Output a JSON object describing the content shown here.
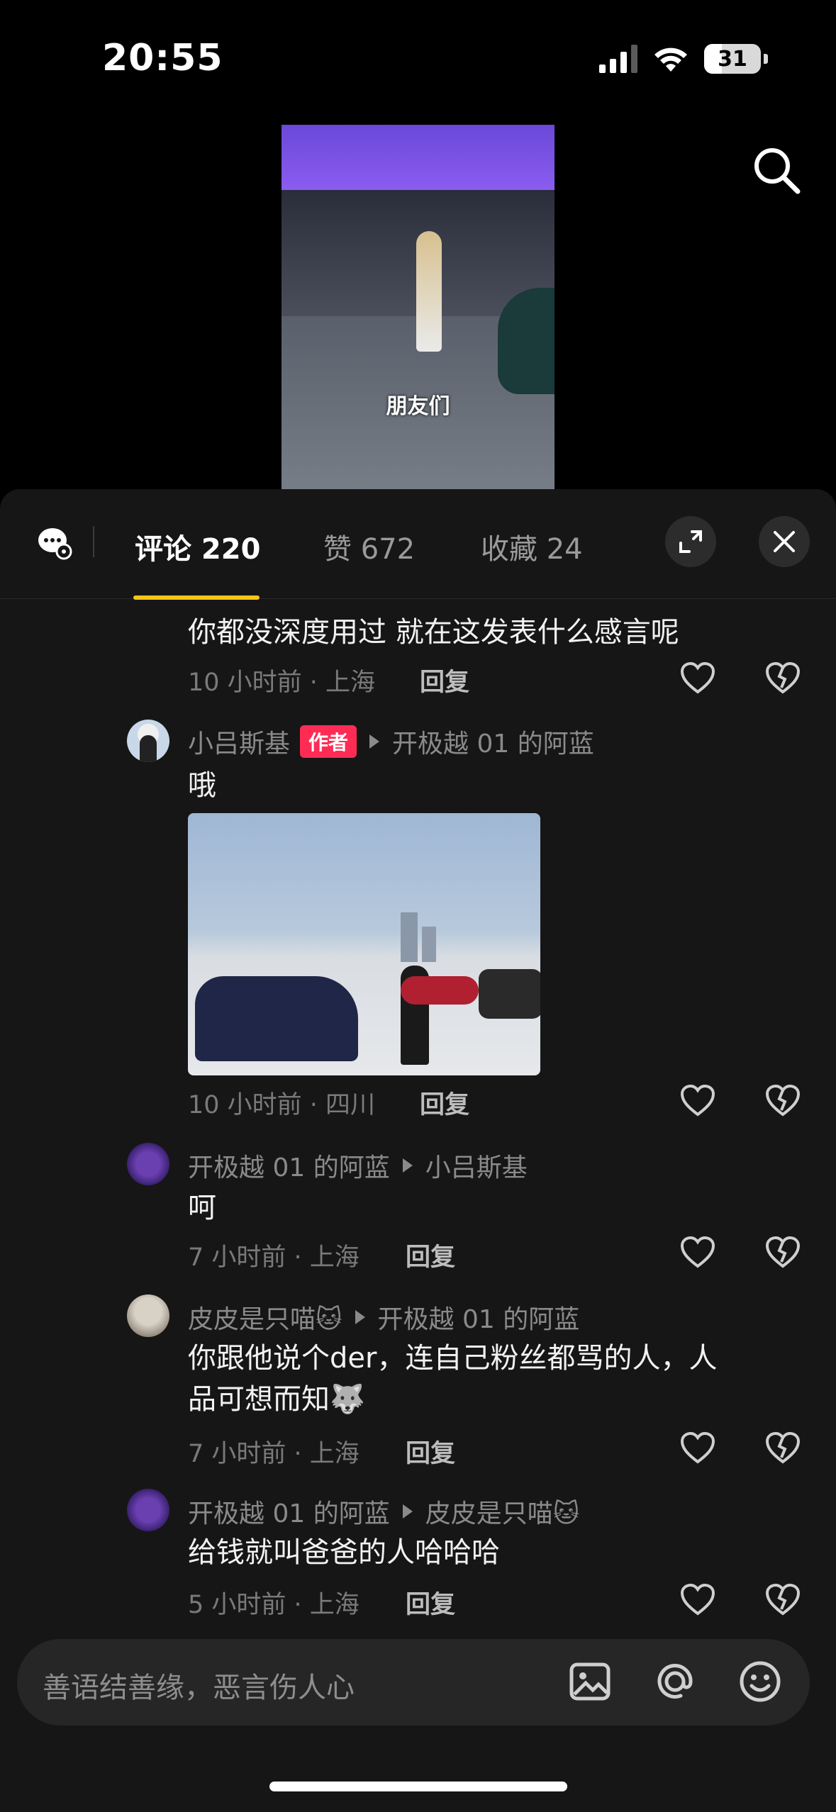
{
  "status_bar": {
    "time": "20:55",
    "battery": "31"
  },
  "video": {
    "caption": "朋友们"
  },
  "tabs": {
    "comments_label": "评论 220",
    "likes_label": "赞 672",
    "favorites_label": "收藏 24"
  },
  "comments": [
    {
      "text": "你都没深度用过 就在这发表什么感言呢",
      "meta": "10 小时前 · 上海",
      "reply_label": "回复"
    },
    {
      "author": "小吕斯基",
      "badge": "作者",
      "reply_to": "开极越 01 的阿蓝",
      "text": "哦",
      "meta": "10 小时前 · 四川",
      "reply_label": "回复"
    },
    {
      "author": "开极越 01 的阿蓝",
      "reply_to": "小吕斯基",
      "text": "呵",
      "meta": "7 小时前 · 上海",
      "reply_label": "回复"
    },
    {
      "author": "皮皮是只喵🐱",
      "reply_to": "开极越 01 的阿蓝",
      "text_line1": "你跟他说个der，连自己粉丝都骂的人，人",
      "text_line2": "品可想而知🐺",
      "meta": "7 小时前 · 上海",
      "reply_label": "回复"
    },
    {
      "author": "开极越 01 的阿蓝",
      "reply_to": "皮皮是只喵🐱",
      "text": "给钱就叫爸爸的人哈哈哈",
      "meta": "5 小时前 · 上海",
      "reply_label": "回复"
    }
  ],
  "input": {
    "placeholder": "善语结善缘，恶言伤人心"
  },
  "icons": [
    "search-icon",
    "comment-settings-icon",
    "expand-icon",
    "close-icon",
    "heart-icon",
    "dislike-icon",
    "image-icon",
    "mention-icon",
    "emoji-icon"
  ],
  "colors": {
    "accent_underline": "#f5c518",
    "author_badge": "#fe2c55",
    "panel_bg": "#161616"
  }
}
